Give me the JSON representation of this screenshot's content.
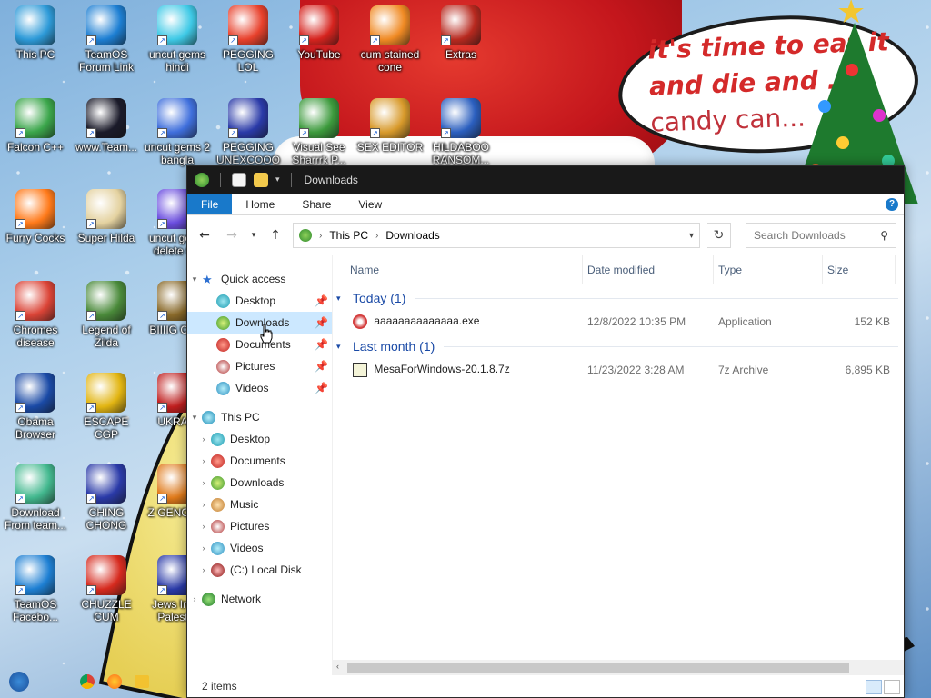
{
  "desktop": {
    "icons": [
      {
        "label": "This PC",
        "color": "#2d9ad8"
      },
      {
        "label": "TeamOS Forum Link",
        "color": "#1d7fd3"
      },
      {
        "label": "uncut gems hindi",
        "color": "#3ec9e6"
      },
      {
        "label": "PEGGING LOL",
        "color": "#e8412c"
      },
      {
        "label": "YouTube",
        "color": "#d6231e"
      },
      {
        "label": "cum stained cone",
        "color": "#f08a24"
      },
      {
        "label": "Extras",
        "color": "#b8291f"
      },
      {
        "label": "Falcon C++",
        "color": "#3ba64b"
      },
      {
        "label": "www.Team...",
        "color": "#1b1b2a"
      },
      {
        "label": "uncut gems 2 bangla",
        "color": "#3f6fdc"
      },
      {
        "label": "PEGGING UNEXCOOO",
        "color": "#2a3aa8"
      },
      {
        "label": "Visual See Sharrrk P...",
        "color": "#3c9a3c"
      },
      {
        "label": "SEX EDITOR",
        "color": "#d89a2b"
      },
      {
        "label": "HILDABOO RANSOM...",
        "color": "#2b5fbf"
      },
      {
        "label": "Furry Cocks",
        "color": "#ff7a1a"
      },
      {
        "label": "Super Hilda",
        "color": "#e4d2a0"
      },
      {
        "label": "uncut gems delete s...",
        "color": "#6b4de0"
      },
      {
        "label": "Chromes disease",
        "color": "#db4437"
      },
      {
        "label": "Legend of Zilda",
        "color": "#4a8a3a"
      },
      {
        "label": "BIIIIG CU...",
        "color": "#8a6a2a"
      },
      {
        "label": "Obama Browser",
        "color": "#1a4aa6"
      },
      {
        "label": "ESCAPE CGP",
        "color": "#e2b512"
      },
      {
        "label": "UKRA...",
        "color": "#c01e1e"
      },
      {
        "label": "Download From team...",
        "color": "#42b88e"
      },
      {
        "label": "CHING CHONG",
        "color": "#2a3aa8"
      },
      {
        "label": "Z GENOC...",
        "color": "#e07a1a"
      },
      {
        "label": "TeamOS Facebo...",
        "color": "#1d7fd3"
      },
      {
        "label": "CHUZZLE CUM",
        "color": "#d62a1e"
      },
      {
        "label": "Jews Inv... Palest...",
        "color": "#2a3aa8"
      }
    ]
  },
  "wallpaper": {
    "sign_lines": [
      "it's time to eat it",
      "and die and ...",
      "candy can..."
    ]
  },
  "window": {
    "title": "Downloads",
    "ribbon_tabs": [
      "File",
      "Home",
      "Share",
      "View"
    ],
    "help": "?",
    "address": {
      "crumbs": [
        "This PC",
        "Downloads"
      ]
    },
    "search_placeholder": "Search Downloads",
    "nav": {
      "quick_access": "Quick access",
      "quick_items": [
        "Desktop",
        "Downloads",
        "Documents",
        "Pictures",
        "Videos"
      ],
      "this_pc": "This PC",
      "pc_items": [
        "Desktop",
        "Documents",
        "Downloads",
        "Music",
        "Pictures",
        "Videos",
        "(C:) Local Disk"
      ],
      "network": "Network"
    },
    "columns": {
      "name": "Name",
      "date": "Date modified",
      "type": "Type",
      "size": "Size"
    },
    "groups": [
      {
        "label": "Today (1)",
        "files": [
          {
            "name": "aaaaaaaaaaaaaa.exe",
            "date": "12/8/2022 10:35 PM",
            "type": "Application",
            "size": "152 KB"
          }
        ]
      },
      {
        "label": "Last month (1)",
        "files": [
          {
            "name": "MesaForWindows-20.1.8.7z",
            "date": "11/23/2022 3:28 AM",
            "type": "7z Archive",
            "size": "6,895 KB"
          }
        ]
      }
    ],
    "status": "2 items"
  }
}
